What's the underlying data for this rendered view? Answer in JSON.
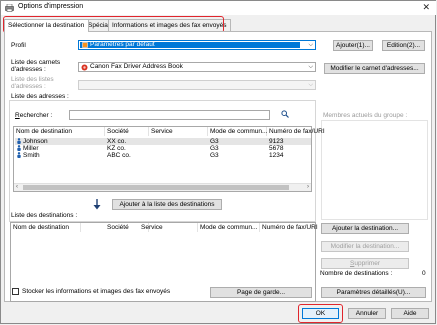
{
  "window": {
    "title": "Options d'impression",
    "close_glyph": "✕"
  },
  "tabs": [
    {
      "label": "Sélectionner la destination",
      "active": true
    },
    {
      "label": "Spécial",
      "active": false
    },
    {
      "label": "Informations et images des fax envoyés",
      "active": false
    }
  ],
  "profile": {
    "label": "Profil",
    "value": "Paramètres par défaut",
    "add_button": "Ajouter(1)...",
    "edit_button": "Edition(2)..."
  },
  "address_books": {
    "label_line1": "Liste des carnets",
    "label_line2": "d'adresses :",
    "value": "Canon Fax Driver Address Book",
    "modify_button": "Modifier le carnet d'adresses..."
  },
  "address_lists": {
    "label_line1": "Liste des listes",
    "label_line2": "d'adresses :"
  },
  "address_list_caption": "Liste des adresses :",
  "search": {
    "label": "Rechercher :",
    "value": "",
    "icon": "search-icon"
  },
  "group_members_label": "Membres actuels du groupe :",
  "columns": [
    "Nom de destination",
    "Société",
    "Service",
    "Mode de commun...",
    "Numéro de fax/URI"
  ],
  "address_rows": [
    {
      "name": "Johnson",
      "company": "XX co.",
      "service": "",
      "mode": "G3",
      "number": "9123"
    },
    {
      "name": "Miller",
      "company": "KZ co.",
      "service": "",
      "mode": "G3",
      "number": "5678"
    },
    {
      "name": "Smith",
      "company": "ABC co.",
      "service": "",
      "mode": "G3",
      "number": "1234"
    }
  ],
  "add_to_destinations_button": "Ajouter à la liste des destinations",
  "destinations_caption": "Liste des destinations :",
  "destination_buttons": {
    "add": "Ajouter la destination...",
    "modify": "Modifier la destination...",
    "delete": "Supprimer"
  },
  "destination_count": {
    "label": "Nombre de destinations :",
    "value": "0"
  },
  "store_checkbox_label": "Stocker les informations et images des fax envoyés",
  "cover_page_button": "Page de garde...",
  "detailed_settings_button": "Paramètres détaillés(U)...",
  "footer": {
    "ok": "OK",
    "cancel": "Annuler",
    "help": "Aide"
  },
  "colors": {
    "highlight_outline": "#e0262d",
    "accent": "#0078d7"
  }
}
